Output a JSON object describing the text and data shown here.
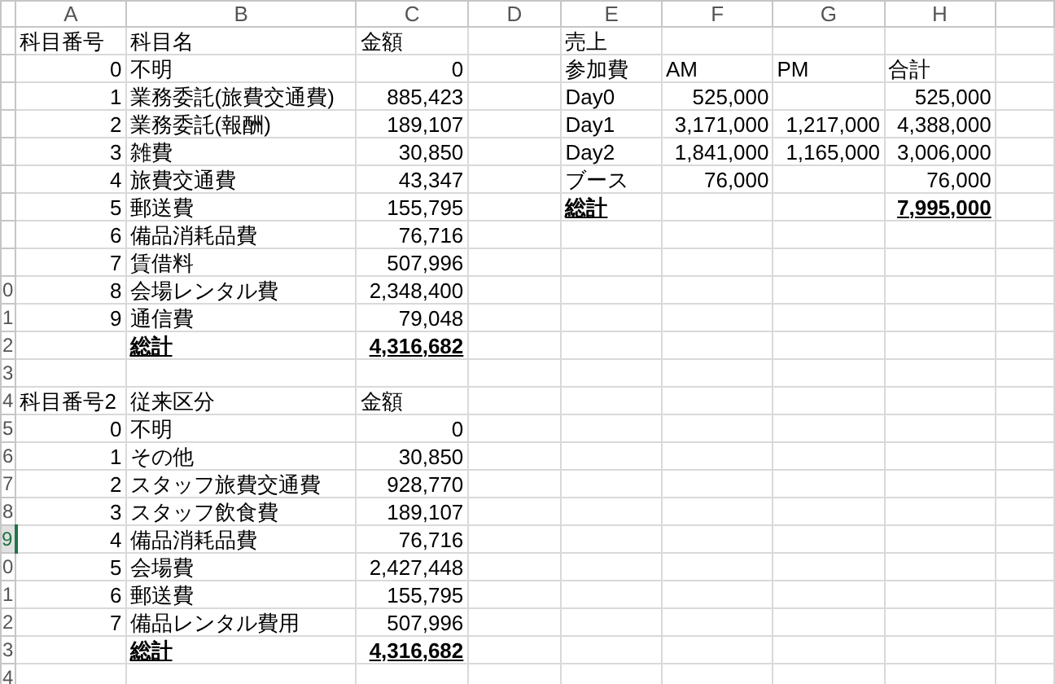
{
  "columns": [
    "A",
    "B",
    "C",
    "D",
    "E",
    "F",
    "G",
    "H"
  ],
  "rows": [
    {
      "selected": false,
      "cells": [
        {
          "text": "科目番号",
          "right": false,
          "total": false
        },
        {
          "text": "科目名",
          "right": false,
          "total": false
        },
        {
          "text": "金額",
          "right": false,
          "total": false
        },
        null,
        {
          "text": "売上",
          "right": false,
          "total": false
        }
      ]
    },
    {
      "selected": false,
      "cells": [
        {
          "text": "0",
          "right": true,
          "total": false
        },
        {
          "text": "不明",
          "right": false,
          "total": false
        },
        {
          "text": "0",
          "right": true,
          "total": false
        },
        null,
        {
          "text": "参加費",
          "right": false,
          "total": false
        },
        {
          "text": "AM",
          "right": false,
          "total": false
        },
        {
          "text": "PM",
          "right": false,
          "total": false
        },
        {
          "text": "合計",
          "right": false,
          "total": false
        }
      ]
    },
    {
      "selected": false,
      "cells": [
        {
          "text": "1",
          "right": true,
          "total": false
        },
        {
          "text": "業務委託(旅費交通費)",
          "right": false,
          "total": false
        },
        {
          "text": "885,423",
          "right": true,
          "total": false
        },
        null,
        {
          "text": "Day0",
          "right": false,
          "total": false
        },
        {
          "text": "525,000",
          "right": true,
          "total": false
        },
        null,
        {
          "text": "525,000",
          "right": true,
          "total": false
        }
      ]
    },
    {
      "selected": false,
      "cells": [
        {
          "text": "2",
          "right": true,
          "total": false
        },
        {
          "text": "業務委託(報酬)",
          "right": false,
          "total": false
        },
        {
          "text": "189,107",
          "right": true,
          "total": false
        },
        null,
        {
          "text": "Day1",
          "right": false,
          "total": false
        },
        {
          "text": "3,171,000",
          "right": true,
          "total": false
        },
        {
          "text": "1,217,000",
          "right": true,
          "total": false
        },
        {
          "text": "4,388,000",
          "right": true,
          "total": false
        }
      ]
    },
    {
      "selected": false,
      "cells": [
        {
          "text": "3",
          "right": true,
          "total": false
        },
        {
          "text": "雑費",
          "right": false,
          "total": false
        },
        {
          "text": "30,850",
          "right": true,
          "total": false
        },
        null,
        {
          "text": "Day2",
          "right": false,
          "total": false
        },
        {
          "text": "1,841,000",
          "right": true,
          "total": false
        },
        {
          "text": "1,165,000",
          "right": true,
          "total": false
        },
        {
          "text": "3,006,000",
          "right": true,
          "total": false
        }
      ]
    },
    {
      "selected": false,
      "cells": [
        {
          "text": "4",
          "right": true,
          "total": false
        },
        {
          "text": "旅費交通費",
          "right": false,
          "total": false
        },
        {
          "text": "43,347",
          "right": true,
          "total": false
        },
        null,
        {
          "text": "ブース",
          "right": false,
          "total": false
        },
        {
          "text": "76,000",
          "right": true,
          "total": false
        },
        null,
        {
          "text": "76,000",
          "right": true,
          "total": false
        }
      ]
    },
    {
      "selected": false,
      "cells": [
        {
          "text": "5",
          "right": true,
          "total": false
        },
        {
          "text": "郵送費",
          "right": false,
          "total": false
        },
        {
          "text": "155,795",
          "right": true,
          "total": false
        },
        null,
        {
          "text": "総計",
          "right": false,
          "total": true
        },
        null,
        null,
        {
          "text": "7,995,000",
          "right": true,
          "total": true
        }
      ]
    },
    {
      "selected": false,
      "cells": [
        {
          "text": "6",
          "right": true,
          "total": false
        },
        {
          "text": "備品消耗品費",
          "right": false,
          "total": false
        },
        {
          "text": "76,716",
          "right": true,
          "total": false
        }
      ]
    },
    {
      "selected": false,
      "cells": [
        {
          "text": "7",
          "right": true,
          "total": false
        },
        {
          "text": "賃借料",
          "right": false,
          "total": false
        },
        {
          "text": "507,996",
          "right": true,
          "total": false
        }
      ]
    },
    {
      "label": "0",
      "selected": false,
      "cells": [
        {
          "text": "8",
          "right": true,
          "total": false
        },
        {
          "text": "会場レンタル費",
          "right": false,
          "total": false
        },
        {
          "text": "2,348,400",
          "right": true,
          "total": false
        }
      ]
    },
    {
      "label": "1",
      "selected": false,
      "cells": [
        {
          "text": "9",
          "right": true,
          "total": false
        },
        {
          "text": "通信費",
          "right": false,
          "total": false
        },
        {
          "text": "79,048",
          "right": true,
          "total": false
        }
      ]
    },
    {
      "label": "2",
      "selected": false,
      "cells": [
        null,
        {
          "text": "総計",
          "right": false,
          "total": true
        },
        {
          "text": "4,316,682",
          "right": true,
          "total": true
        }
      ]
    },
    {
      "label": "3",
      "selected": false,
      "cells": []
    },
    {
      "label": "4",
      "selected": false,
      "cells": [
        {
          "text": "科目番号2",
          "right": false,
          "total": false
        },
        {
          "text": "従来区分",
          "right": false,
          "total": false
        },
        {
          "text": "金額",
          "right": false,
          "total": false
        }
      ]
    },
    {
      "label": "5",
      "selected": false,
      "cells": [
        {
          "text": "0",
          "right": true,
          "total": false
        },
        {
          "text": "不明",
          "right": false,
          "total": false
        },
        {
          "text": "0",
          "right": true,
          "total": false
        }
      ]
    },
    {
      "label": "6",
      "selected": false,
      "cells": [
        {
          "text": "1",
          "right": true,
          "total": false
        },
        {
          "text": "その他",
          "right": false,
          "total": false
        },
        {
          "text": "30,850",
          "right": true,
          "total": false
        }
      ]
    },
    {
      "label": "7",
      "selected": false,
      "cells": [
        {
          "text": "2",
          "right": true,
          "total": false
        },
        {
          "text": "スタッフ旅費交通費",
          "right": false,
          "total": false
        },
        {
          "text": "928,770",
          "right": true,
          "total": false
        }
      ]
    },
    {
      "label": "8",
      "selected": false,
      "cells": [
        {
          "text": "3",
          "right": true,
          "total": false
        },
        {
          "text": "スタッフ飲食費",
          "right": false,
          "total": false
        },
        {
          "text": "189,107",
          "right": true,
          "total": false
        }
      ]
    },
    {
      "label": "9",
      "selected": true,
      "cells": [
        {
          "text": "4",
          "right": true,
          "total": false
        },
        {
          "text": "備品消耗品費",
          "right": false,
          "total": false
        },
        {
          "text": "76,716",
          "right": true,
          "total": false
        }
      ]
    },
    {
      "label": "0",
      "selected": false,
      "cells": [
        {
          "text": "5",
          "right": true,
          "total": false
        },
        {
          "text": "会場費",
          "right": false,
          "total": false
        },
        {
          "text": "2,427,448",
          "right": true,
          "total": false
        }
      ]
    },
    {
      "label": "1",
      "selected": false,
      "cells": [
        {
          "text": "6",
          "right": true,
          "total": false
        },
        {
          "text": "郵送費",
          "right": false,
          "total": false
        },
        {
          "text": "155,795",
          "right": true,
          "total": false
        }
      ]
    },
    {
      "label": "2",
      "selected": false,
      "cells": [
        {
          "text": "7",
          "right": true,
          "total": false
        },
        {
          "text": "備品レンタル費用",
          "right": false,
          "total": false
        },
        {
          "text": "507,996",
          "right": true,
          "total": false
        }
      ]
    },
    {
      "label": "3",
      "selected": false,
      "cells": [
        null,
        {
          "text": "総計",
          "right": false,
          "total": true
        },
        {
          "text": "4,316,682",
          "right": true,
          "total": true
        }
      ]
    },
    {
      "label": "4",
      "selected": false,
      "cells": []
    }
  ]
}
